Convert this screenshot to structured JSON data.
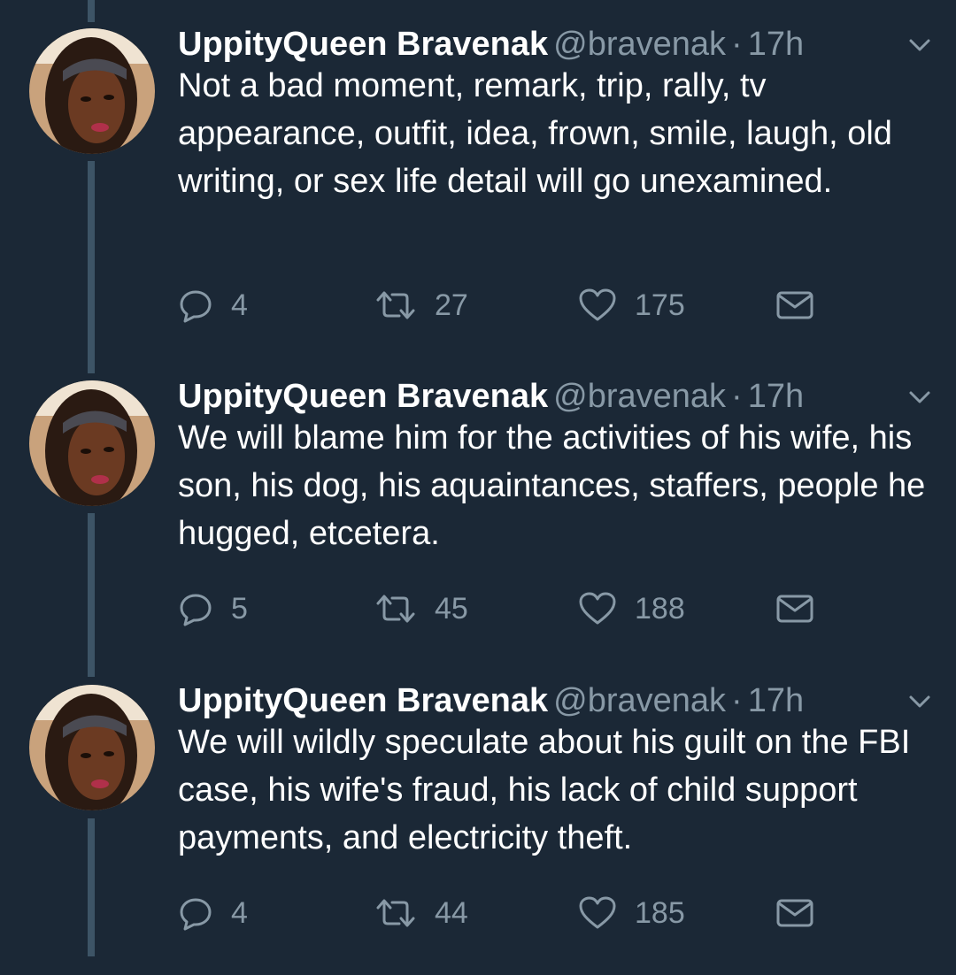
{
  "colors": {
    "background": "#1b2836",
    "text": "#ffffff",
    "secondary": "#8899a6",
    "thread_line": "#3d5466"
  },
  "tweets": [
    {
      "display_name": "UppityQueen Bravenak",
      "handle": "@bravenak",
      "separator": "·",
      "time": "17h",
      "text": "Not a bad moment, remark, trip, rally, tv appearance, outfit, idea, frown, smile, laugh, old writing, or sex life detail will go unexamined.",
      "replies": "4",
      "retweets": "27",
      "likes": "175",
      "icons": [
        "avatar",
        "chevron-down-icon",
        "reply-icon",
        "retweet-icon",
        "heart-icon",
        "envelope-icon"
      ]
    },
    {
      "display_name": "UppityQueen Bravenak",
      "handle": "@bravenak",
      "separator": "·",
      "time": "17h",
      "text": "We will blame him for the activities of his wife, his son, his dog, his aquaintances, staffers, people he hugged, etcetera.",
      "replies": "5",
      "retweets": "45",
      "likes": "188",
      "icons": [
        "avatar",
        "chevron-down-icon",
        "reply-icon",
        "retweet-icon",
        "heart-icon",
        "envelope-icon"
      ]
    },
    {
      "display_name": "UppityQueen Bravenak",
      "handle": "@bravenak",
      "separator": "·",
      "time": "17h",
      "text": "We will wildly speculate about his guilt on the FBI case, his wife's fraud, his lack of child support payments, and electricity theft.",
      "replies": "4",
      "retweets": "44",
      "likes": "185",
      "icons": [
        "avatar",
        "chevron-down-icon",
        "reply-icon",
        "retweet-icon",
        "heart-icon",
        "envelope-icon"
      ]
    }
  ]
}
